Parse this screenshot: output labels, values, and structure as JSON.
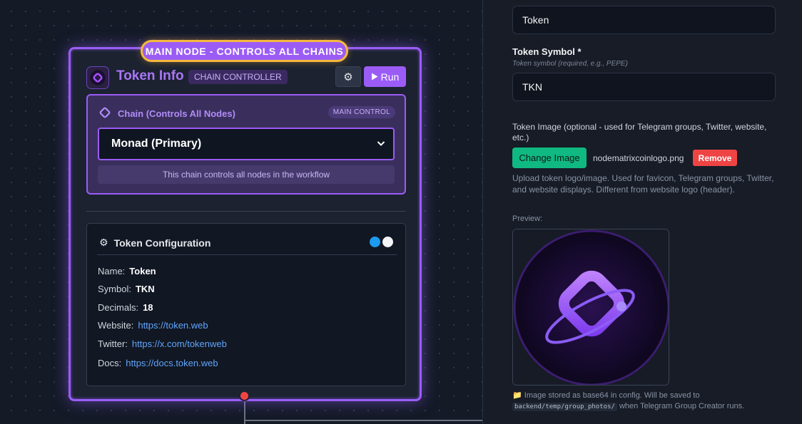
{
  "canvas": {
    "main_badge": "MAIN NODE - CONTROLS ALL CHAINS",
    "node": {
      "title": "Token Info",
      "tag": "CHAIN CONTROLLER",
      "run_label": "Run",
      "chain": {
        "label": "Chain (Controls All Nodes)",
        "badge": "MAIN CONTROL",
        "selected": "Monad (Primary)",
        "note": "This chain controls all nodes in the workflow"
      },
      "config": {
        "title": "Token Configuration",
        "rows": [
          {
            "key": "Name:",
            "value": "Token"
          },
          {
            "key": "Symbol:",
            "value": "TKN"
          },
          {
            "key": "Decimals:",
            "value": "18"
          },
          {
            "key": "Website:",
            "value": "https://token.web"
          },
          {
            "key": "Twitter:",
            "value": "https://x.com/tokenweb"
          },
          {
            "key": "Docs:",
            "value": "https://docs.token.web"
          }
        ]
      }
    }
  },
  "panel": {
    "token_name_value": "Token",
    "symbol": {
      "label": "Token Symbol *",
      "hint": "Token symbol (required, e.g., PEPE)",
      "value": "TKN"
    },
    "image": {
      "label": "Token Image (optional - used for Telegram groups, Twitter, website, etc.)",
      "change_label": "Change Image",
      "filename": "nodematrixcoinlogo.png",
      "remove_label": "Remove",
      "upload_note": "Upload token logo/image. Used for favicon, Telegram groups, Twitter, and website displays. Different from website logo (header).",
      "preview_label": "Preview:",
      "stored_prefix": "Image stored as base64 in config. Will be saved to",
      "stored_path": "backend/temp/group_photos/",
      "stored_suffix": "when Telegram Group Creator runs."
    }
  },
  "colors": {
    "accent": "#9b5cf6",
    "badge_border": "#f5b83d",
    "success": "#10b981",
    "danger": "#ef4444",
    "link": "#60a5fa"
  },
  "icons": [
    "gear-icon",
    "play-icon",
    "diamond-chain-icon",
    "chevron-down-icon",
    "folder-icon",
    "twitter-dot-icon",
    "docs-dot-icon"
  ]
}
